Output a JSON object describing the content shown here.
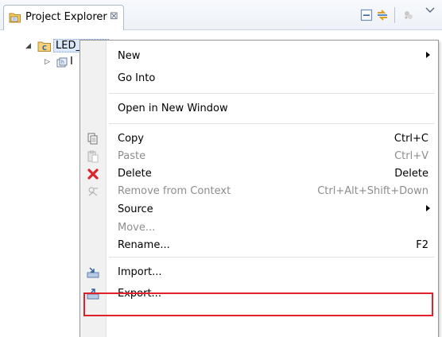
{
  "view": {
    "title": "Project Explorer",
    "close_glyph": "⊠"
  },
  "toolbar": {
    "items": [
      {
        "icon": "collapse-all-icon"
      },
      {
        "icon": "link-with-editor-icon"
      },
      {
        "icon": "focus-icon"
      },
      {
        "icon": "view-menu-icon"
      }
    ]
  },
  "tree": {
    "root_label": "LED_Blink",
    "child_label": "I"
  },
  "menu": {
    "items": {
      "new": "New",
      "go_into": "Go Into",
      "open_new_window": "Open in New Window",
      "copy": "Copy",
      "copy_acc": "Ctrl+C",
      "paste": "Paste",
      "paste_acc": "Ctrl+V",
      "delete": "Delete",
      "delete_acc": "Delete",
      "remove_ctx": "Remove from Context",
      "remove_ctx_acc": "Ctrl+Alt+Shift+Down",
      "source": "Source",
      "move": "Move...",
      "rename": "Rename...",
      "rename_acc": "F2",
      "import": "Import...",
      "export": "Export..."
    }
  },
  "colors": {
    "highlight_border": "#e0202b",
    "delete_icon": "#d8262f"
  }
}
